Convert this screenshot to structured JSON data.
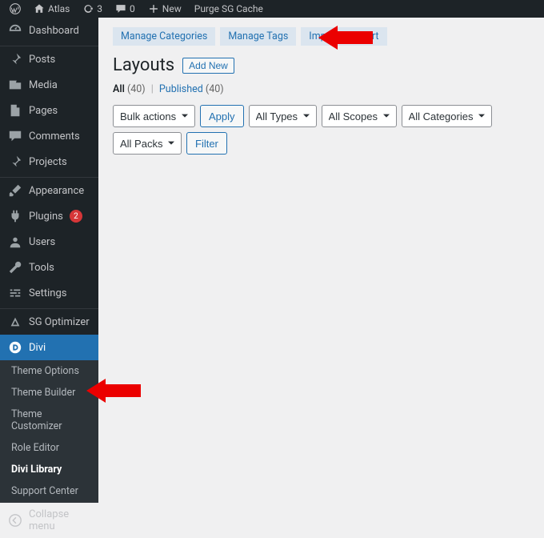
{
  "topbar": {
    "site_name": "Atlas",
    "updates_count": "3",
    "comments_count": "0",
    "new_label": "New",
    "purge_label": "Purge SG Cache"
  },
  "sidebar": {
    "dashboard": "Dashboard",
    "posts": "Posts",
    "media": "Media",
    "pages": "Pages",
    "comments": "Comments",
    "projects": "Projects",
    "appearance": "Appearance",
    "plugins": "Plugins",
    "plugins_badge": "2",
    "users": "Users",
    "tools": "Tools",
    "settings": "Settings",
    "sg": "SG Optimizer",
    "divi": "Divi",
    "submenu": {
      "theme_options": "Theme Options",
      "theme_builder": "Theme Builder",
      "theme_customizer": "Theme Customizer",
      "role_editor": "Role Editor",
      "divi_library": "Divi Library",
      "support_center": "Support Center"
    },
    "collapse": "Collapse menu"
  },
  "content": {
    "pills": {
      "categories": "Manage Categories",
      "tags": "Manage Tags",
      "import": "Import & Export"
    },
    "title": "Layouts",
    "add_new": "Add New",
    "status": {
      "all": "All",
      "all_count": "(40)",
      "published": "Published",
      "published_count": "(40)"
    },
    "filters": {
      "bulk": "Bulk actions",
      "apply": "Apply",
      "types": "All Types",
      "scopes": "All Scopes",
      "categories": "All Categories",
      "packs": "All Packs",
      "filter": "Filter"
    }
  },
  "colors": {
    "arrow": "#eb0000"
  }
}
